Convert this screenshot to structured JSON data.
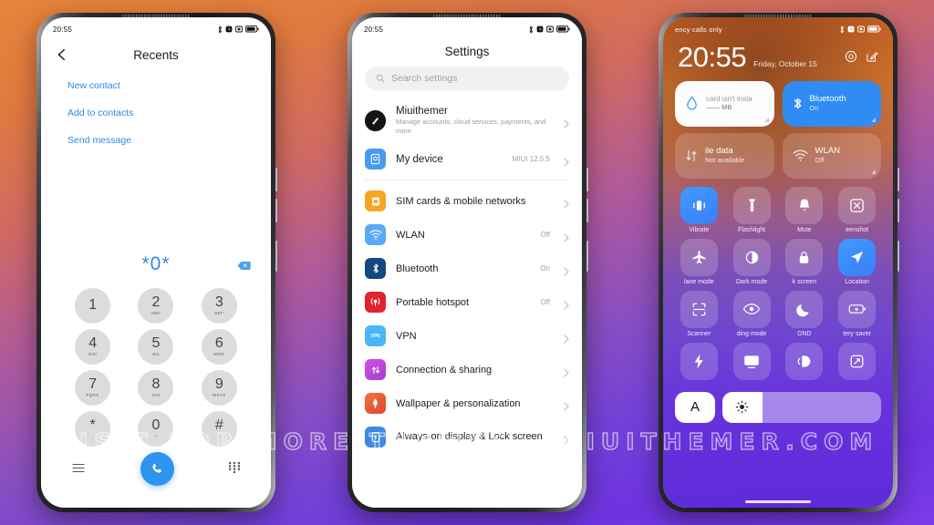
{
  "watermark": "VISIT FOR MORE THEMES - MIUITHEMER.COM",
  "colors": {
    "accent_blue": "#2f88e6",
    "tile_blue": "#2f8cf5",
    "key_gray": "#dcdcdc",
    "bg_orange": "#e8833a",
    "bg_purple": "#6e33e0"
  },
  "phone1": {
    "status": {
      "time": "20:55"
    },
    "header": {
      "title": "Recents",
      "back_icon": "back-arrow-icon"
    },
    "actions": [
      {
        "label": "New contact"
      },
      {
        "label": "Add to contacts"
      },
      {
        "label": "Send message"
      }
    ],
    "dialer": {
      "number": "*0*",
      "backspace_icon": "backspace-icon",
      "keys": [
        {
          "digit": "1",
          "letters": ""
        },
        {
          "digit": "2",
          "letters": "ABC"
        },
        {
          "digit": "3",
          "letters": "DEF"
        },
        {
          "digit": "4",
          "letters": "GHI"
        },
        {
          "digit": "5",
          "letters": "JKL"
        },
        {
          "digit": "6",
          "letters": "MNO"
        },
        {
          "digit": "7",
          "letters": "PQRS"
        },
        {
          "digit": "8",
          "letters": "TUV"
        },
        {
          "digit": "9",
          "letters": "WXYZ"
        },
        {
          "digit": "*",
          "letters": ","
        },
        {
          "digit": "0",
          "letters": "+"
        },
        {
          "digit": "#",
          "letters": ";"
        }
      ],
      "bar": {
        "menu_icon": "menu-icon",
        "call_icon": "phone-call-icon",
        "keypad_icon": "keypad-icon"
      }
    }
  },
  "phone2": {
    "status": {
      "time": "20:55"
    },
    "title": "Settings",
    "search": {
      "placeholder": "Search settings",
      "icon": "search-icon"
    },
    "account": {
      "name": "Miuithemer",
      "subtitle": "Manage accounts, cloud services, payments, and more"
    },
    "device": {
      "label": "My device",
      "value": "MIUI 12.5.5"
    },
    "items": [
      {
        "label": "SIM cards & mobile networks",
        "value": "",
        "icon": "sim-card-icon",
        "color": "#f5a623"
      },
      {
        "label": "WLAN",
        "value": "Off",
        "icon": "wifi-icon",
        "color": "#5aaaf5"
      },
      {
        "label": "Bluetooth",
        "value": "On",
        "icon": "bluetooth-icon",
        "color": "#13497f"
      },
      {
        "label": "Portable hotspot",
        "value": "Off",
        "icon": "hotspot-icon",
        "color": "#e0232e"
      },
      {
        "label": "VPN",
        "value": "",
        "icon": "vpn-icon",
        "color": "#4ab6f5"
      },
      {
        "label": "Connection & sharing",
        "value": "",
        "icon": "connection-icon",
        "color": "#b93fd6"
      },
      {
        "label": "Wallpaper & personalization",
        "value": "",
        "icon": "wallpaper-icon",
        "color": "#ef5a33"
      },
      {
        "label": "Always-on display & Lock screen",
        "value": "",
        "icon": "lockscreen-icon",
        "color": "#3d8ae0"
      }
    ]
  },
  "phone3": {
    "status": {
      "carrier": "ency calls only"
    },
    "lock": {
      "time": "20:55",
      "date": "Friday, October 15",
      "camera_icon": "camera-icon",
      "note_icon": "note-edit-icon"
    },
    "big_tiles": [
      {
        "title": "card isn't insta",
        "sub": "—— MB",
        "icon": "data-drop-icon",
        "style": "white"
      },
      {
        "title": "Bluetooth",
        "sub": "On",
        "icon": "bluetooth-icon",
        "style": "blue"
      },
      {
        "title": "ile data",
        "sub": "Not available",
        "icon": "mobile-data-icon",
        "style": "dim"
      },
      {
        "title": "WLAN",
        "sub": "Off",
        "icon": "wifi-icon",
        "style": "dim"
      }
    ],
    "toggles": [
      {
        "label": "Vibrate",
        "icon": "vibrate-icon",
        "on": true
      },
      {
        "label": "Flashlight",
        "icon": "flashlight-icon",
        "on": false
      },
      {
        "label": "Mute",
        "icon": "bell-icon",
        "on": false
      },
      {
        "label": "eenshot",
        "icon": "screenshot-icon",
        "on": false
      },
      {
        "label": "lane mode",
        "icon": "airplane-icon",
        "on": false
      },
      {
        "label": "Dark mode",
        "icon": "dark-mode-icon",
        "on": false
      },
      {
        "label": "k screen",
        "icon": "lock-icon",
        "on": false
      },
      {
        "label": "Location",
        "icon": "location-icon",
        "on": true
      },
      {
        "label": "Scanner",
        "icon": "scanner-icon",
        "on": false
      },
      {
        "label": "ding mode",
        "icon": "reading-mode-icon",
        "on": false
      },
      {
        "label": "DND",
        "icon": "moon-icon",
        "on": false
      },
      {
        "label": "tery saver",
        "icon": "battery-saver-icon",
        "on": false
      },
      {
        "label": "",
        "icon": "lightning-icon",
        "on": false
      },
      {
        "label": "",
        "icon": "cast-icon",
        "on": false
      },
      {
        "label": "",
        "icon": "nfc-icon",
        "on": false
      },
      {
        "label": "",
        "icon": "rotate-icon",
        "on": false
      }
    ],
    "brightness": {
      "auto_label": "A",
      "icon": "brightness-icon",
      "percent": 25
    }
  }
}
